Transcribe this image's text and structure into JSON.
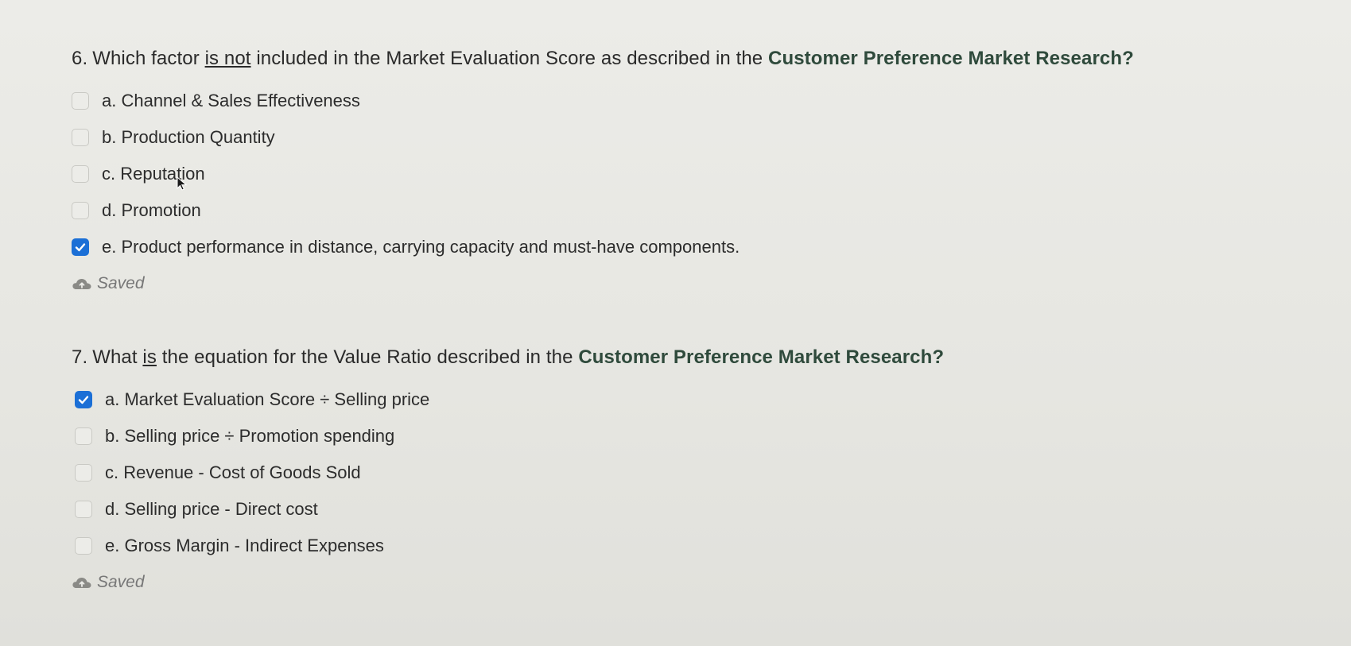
{
  "questions": [
    {
      "number": "6.",
      "title_pre": "Which factor",
      "title_emph": "is not",
      "title_mid": "included in the Market Evaluation Score as described in the",
      "title_source": "Customer Preference Market Research?",
      "options": [
        {
          "label": "a. Channel & Sales Effectiveness",
          "checked": false
        },
        {
          "label": "b. Production Quantity",
          "checked": false
        },
        {
          "label": "c. Reputation",
          "checked": false
        },
        {
          "label": "d. Promotion",
          "checked": false
        },
        {
          "label": "e. Product performance in distance, carrying capacity and must-have components.",
          "checked": true
        }
      ],
      "status": "Saved"
    },
    {
      "number": "7.",
      "title_pre": "What",
      "title_emph": "is",
      "title_mid": "the equation for the Value Ratio described in the",
      "title_source": "Customer Preference Market Research?",
      "options": [
        {
          "label": "a. Market Evaluation Score ÷ Selling price",
          "checked": true
        },
        {
          "label": "b. Selling price ÷ Promotion spending",
          "checked": false
        },
        {
          "label": "c. Revenue - Cost of Goods Sold",
          "checked": false
        },
        {
          "label": "d. Selling price - Direct cost",
          "checked": false
        },
        {
          "label": "e. Gross Margin - Indirect Expenses",
          "checked": false
        }
      ],
      "status": "Saved"
    }
  ],
  "colors": {
    "checkbox_checked": "#1b6fd6",
    "source_text": "#2f4a3c",
    "status_text": "#777777"
  },
  "icons": {
    "checked": "checkmark-icon",
    "saved": "cloud-saved-icon",
    "pointer": "mouse-pointer-icon"
  }
}
